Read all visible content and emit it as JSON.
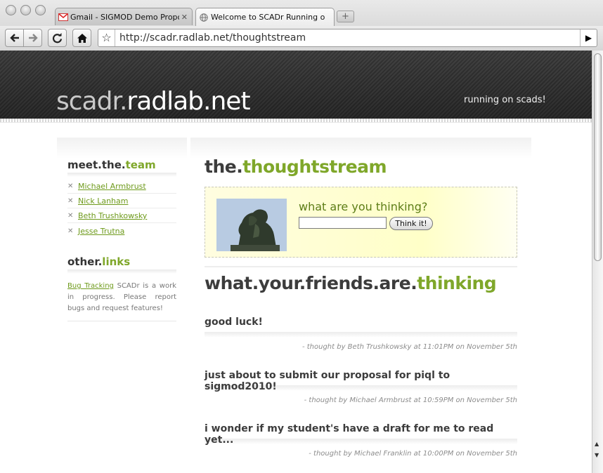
{
  "browser": {
    "tabs": [
      {
        "title": "Gmail - SIGMOD Demo Propo",
        "favicon": "gmail-icon",
        "active": false
      },
      {
        "title": "Welcome to SCADr Running o",
        "favicon": "globe-icon",
        "active": true
      }
    ],
    "url": "http://scadr.radlab.net/thoughtstream",
    "close_glyph": "✕",
    "new_tab_glyph": "+"
  },
  "site": {
    "title_part1": "scadr.",
    "title_part2": "radlab.net",
    "tagline": "running on scads!"
  },
  "sidebar": {
    "team_title_a": "meet.the.",
    "team_title_b": "team",
    "members": [
      "Michael Armbrust",
      "Nick Lanham",
      "Beth Trushkowsky",
      "Jesse Trutna"
    ],
    "links_title_a": "other.",
    "links_title_b": "links",
    "bug_link": "Bug Tracking",
    "links_text": " SCADr is a work in progress. Please report bugs and request features!"
  },
  "main": {
    "title_a": "the.",
    "title_b": "thoughtstream",
    "prompt": "what are you thinking?",
    "input_value": "",
    "button_label": "Think it!",
    "friends_title_a": "what.your.friends.are.",
    "friends_title_b": "thinking",
    "thoughts": [
      {
        "text": "good luck!",
        "meta": "- thought by Beth Trushkowsky at 11:01PM on November 5th"
      },
      {
        "text": "just about to submit our proposal for piql to sigmod2010!",
        "meta": "- thought by Michael Armbrust at 10:59PM on November 5th"
      },
      {
        "text": "i wonder if my student's have a draft for me to read yet...",
        "meta": "- thought by Michael Franklin at 10:00PM on November 5th"
      }
    ]
  },
  "colors": {
    "accent": "#7fa72a",
    "link": "#6e9a1b",
    "header": "#333333"
  }
}
